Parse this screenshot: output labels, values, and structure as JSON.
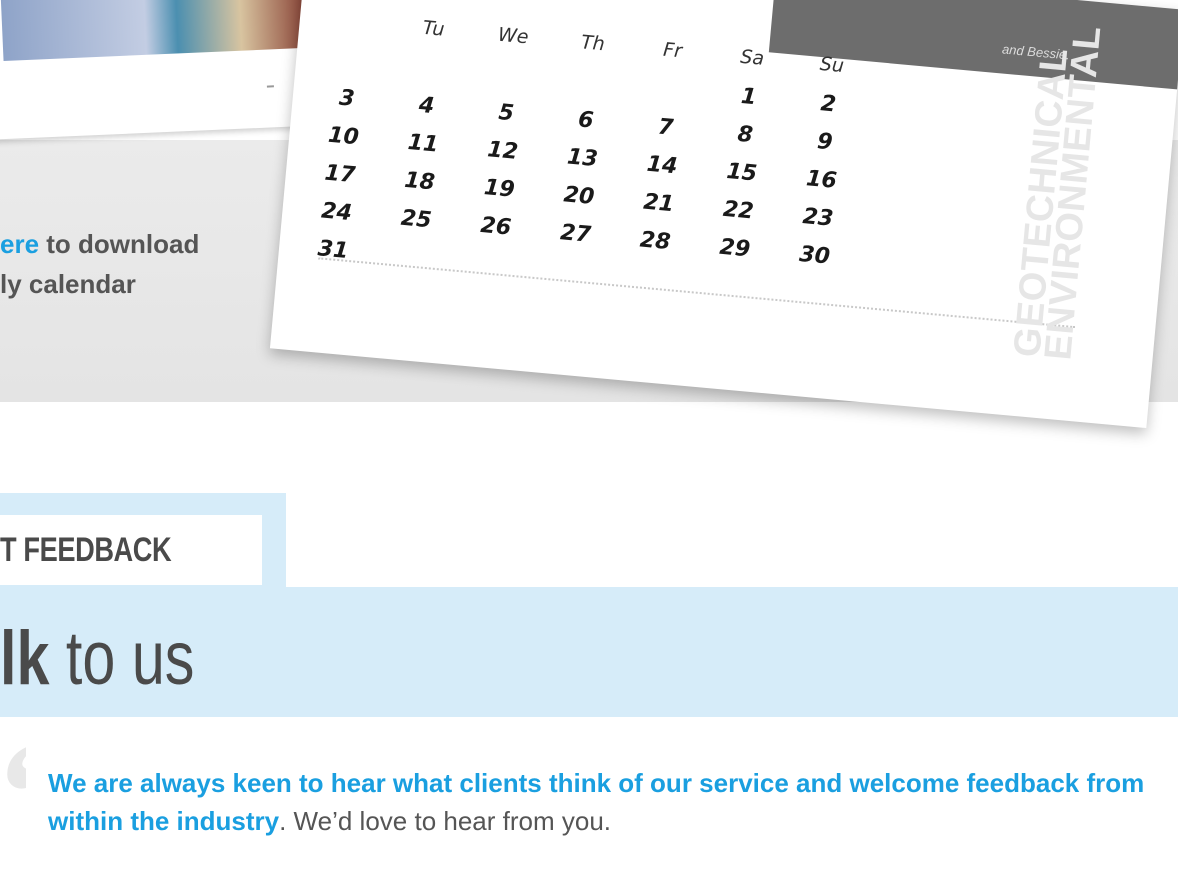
{
  "download": {
    "link_text": "ere",
    "line1_rest": " to download",
    "line2": "ly calendar"
  },
  "calendar": {
    "header_text": "and Bessie.",
    "weekdays": [
      "Tu",
      "We",
      "Th",
      "Fr",
      "Sa",
      "Su"
    ],
    "days": [
      [
        "",
        "",
        "",
        "",
        "",
        "1",
        "2"
      ],
      [
        "3",
        "4",
        "5",
        "6",
        "7",
        "8",
        "9"
      ],
      [
        "10",
        "11",
        "12",
        "13",
        "14",
        "15",
        "16"
      ],
      [
        "17",
        "18",
        "19",
        "20",
        "21",
        "22",
        "23"
      ],
      [
        "24",
        "25",
        "26",
        "27",
        "28",
        "29",
        "30"
      ],
      [
        "31",
        "",
        "",
        "",
        "",
        "",
        ""
      ]
    ],
    "brand_line1": "GEOTECHNICAL",
    "brand_line2": "ENVIRONMENTAL"
  },
  "feedback": {
    "section_title": "T FEEDBACK",
    "heading_bold": "lk",
    "heading_rest": " to us",
    "quote_glyph": "“",
    "highlight": "We are always keen to hear what clients think of our service and welcome feedback from within the industry",
    "rest": ". We’d love to hear from you."
  }
}
